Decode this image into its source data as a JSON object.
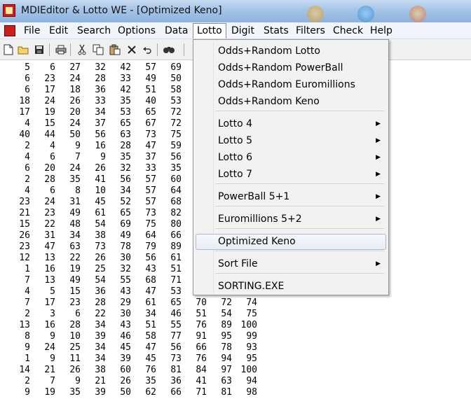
{
  "window": {
    "title": "MDIEditor & Lotto WE - [Optimized Keno]"
  },
  "menubar": {
    "items": [
      "File",
      "Edit",
      "Search",
      "Options",
      "Data",
      "Lotto",
      "Digit",
      "Stats",
      "Filters",
      "Check",
      "Help"
    ],
    "active": "Lotto"
  },
  "toolbar": {
    "icons": [
      "new-file-icon",
      "open-folder-icon",
      "save-icon",
      "print-icon",
      "cut-icon",
      "copy-icon",
      "paste-icon",
      "delete-icon",
      "undo-icon",
      "find-icon"
    ]
  },
  "document": {
    "rows": [
      [
        "5",
        "6",
        "27",
        "32",
        "42",
        "57",
        "69"
      ],
      [
        "6",
        "23",
        "24",
        "28",
        "33",
        "49",
        "50"
      ],
      [
        "6",
        "17",
        "18",
        "36",
        "42",
        "51",
        "58"
      ],
      [
        "18",
        "24",
        "26",
        "33",
        "35",
        "40",
        "53"
      ],
      [
        "17",
        "19",
        "20",
        "34",
        "53",
        "65",
        "72"
      ],
      [
        "4",
        "15",
        "24",
        "37",
        "65",
        "67",
        "72"
      ],
      [
        "40",
        "44",
        "50",
        "56",
        "63",
        "73",
        "75"
      ],
      [
        "2",
        "4",
        "9",
        "16",
        "28",
        "47",
        "59"
      ],
      [
        "4",
        "6",
        "7",
        "9",
        "35",
        "37",
        "56"
      ],
      [
        "6",
        "20",
        "24",
        "26",
        "32",
        "33",
        "35"
      ],
      [
        "2",
        "28",
        "35",
        "41",
        "56",
        "57",
        "60"
      ],
      [
        "4",
        "6",
        "8",
        "10",
        "34",
        "57",
        "64"
      ],
      [
        "23",
        "24",
        "31",
        "45",
        "52",
        "57",
        "68"
      ],
      [
        "21",
        "23",
        "49",
        "61",
        "65",
        "73",
        "82"
      ],
      [
        "15",
        "22",
        "48",
        "54",
        "69",
        "75",
        "80"
      ],
      [
        "26",
        "31",
        "34",
        "38",
        "49",
        "64",
        "66"
      ],
      [
        "23",
        "47",
        "63",
        "73",
        "78",
        "79",
        "89"
      ],
      [
        "12",
        "13",
        "22",
        "26",
        "30",
        "56",
        "61"
      ],
      [
        "1",
        "16",
        "19",
        "25",
        "32",
        "43",
        "51"
      ],
      [
        "7",
        "13",
        "49",
        "54",
        "55",
        "68",
        "71"
      ],
      [
        "4",
        "5",
        "15",
        "36",
        "43",
        "47",
        "53"
      ],
      [
        "7",
        "17",
        "23",
        "28",
        "29",
        "61",
        "65",
        "70",
        "72",
        "74"
      ],
      [
        "2",
        "3",
        "6",
        "22",
        "30",
        "34",
        "46",
        "51",
        "54",
        "75"
      ],
      [
        "13",
        "16",
        "28",
        "34",
        "43",
        "51",
        "55",
        "76",
        "89",
        "100"
      ],
      [
        "8",
        "9",
        "10",
        "39",
        "46",
        "58",
        "77",
        "91",
        "95",
        "99"
      ],
      [
        "9",
        "24",
        "25",
        "34",
        "45",
        "47",
        "56",
        "66",
        "78",
        "93"
      ],
      [
        "1",
        "9",
        "11",
        "34",
        "39",
        "45",
        "73",
        "76",
        "94",
        "95"
      ],
      [
        "14",
        "21",
        "26",
        "38",
        "60",
        "76",
        "81",
        "84",
        "97",
        "100"
      ],
      [
        "2",
        "7",
        "9",
        "21",
        "26",
        "35",
        "36",
        "41",
        "63",
        "94"
      ],
      [
        "9",
        "19",
        "35",
        "39",
        "50",
        "62",
        "66",
        "71",
        "81",
        "98"
      ]
    ]
  },
  "lotto_menu": {
    "items": [
      {
        "label": "Odds+Random Lotto",
        "submenu": false
      },
      {
        "label": "Odds+Random PowerBall",
        "submenu": false
      },
      {
        "label": "Odds+Random Euromillions",
        "submenu": false
      },
      {
        "label": "Odds+Random Keno",
        "submenu": false
      },
      {
        "label": "Lotto 4",
        "submenu": true
      },
      {
        "label": "Lotto 5",
        "submenu": true
      },
      {
        "label": "Lotto 6",
        "submenu": true
      },
      {
        "label": "Lotto 7",
        "submenu": true
      },
      {
        "label": "PowerBall 5+1",
        "submenu": true
      },
      {
        "label": "Euromillions 5+2",
        "submenu": true
      },
      {
        "label": "Optimized Keno",
        "submenu": false,
        "highlighted": true
      },
      {
        "label": "Sort File",
        "submenu": true
      },
      {
        "label": "SORTING.EXE",
        "submenu": false
      }
    ]
  }
}
